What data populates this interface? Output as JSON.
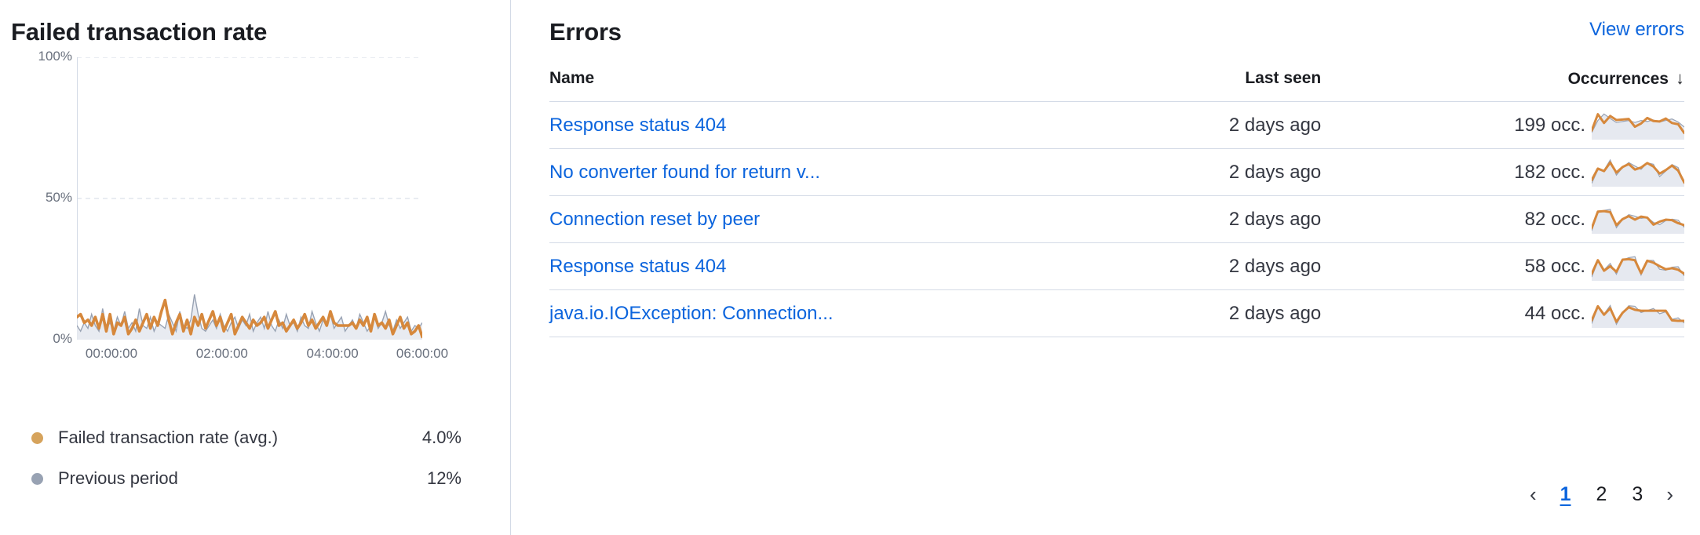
{
  "chart_panel": {
    "title": "Failed transaction rate",
    "legend": [
      {
        "label": "Failed transaction rate (avg.)",
        "value": "4.0%",
        "color": "#d6a35c"
      },
      {
        "label": "Previous period",
        "value": "12%",
        "color": "#98a2b3"
      }
    ]
  },
  "chart_data": {
    "type": "line",
    "title": "Failed transaction rate",
    "xlabel": "",
    "ylabel": "",
    "ylim": [
      0,
      100
    ],
    "yticks": [
      "0%",
      "50%",
      "100%"
    ],
    "ytick_values": [
      0,
      50,
      100
    ],
    "grid": true,
    "legend_position": "bottom",
    "x": [
      "00:00:00",
      "02:00:00",
      "04:00:00",
      "06:00:00"
    ],
    "xtick_labels": [
      "00:00:00",
      "02:00:00",
      "04:00:00",
      "06:00:00"
    ],
    "xtick_positions_pct": [
      10,
      42,
      74,
      100
    ],
    "series": [
      {
        "name": "Failed transaction rate (avg.)",
        "color": "#d6883c",
        "summary_value": "4.0%",
        "values": [
          8,
          9,
          6,
          7,
          5,
          8,
          4,
          9,
          3,
          9,
          2,
          6,
          5,
          8,
          2,
          4,
          7,
          3,
          6,
          9,
          4,
          8,
          5,
          10,
          14,
          7,
          2,
          6,
          9,
          3,
          7,
          2,
          8,
          5,
          9,
          4,
          7,
          10,
          5,
          8,
          3,
          6,
          9,
          2,
          5,
          8,
          6,
          4,
          7,
          5,
          6,
          8,
          4,
          7,
          10,
          5,
          6,
          3,
          5,
          7,
          4,
          6,
          9,
          5,
          7,
          4,
          6,
          8,
          5,
          10,
          6,
          5,
          5,
          5,
          5,
          6,
          4,
          7,
          5,
          8,
          3,
          9,
          5,
          6,
          4,
          7,
          2,
          5,
          8,
          4,
          6,
          2,
          3,
          5,
          1
        ]
      },
      {
        "name": "Previous period",
        "color": "#98a2b3",
        "summary_value": "12%",
        "values": [
          5,
          3,
          6,
          4,
          9,
          5,
          3,
          11,
          4,
          6,
          3,
          8,
          5,
          10,
          4,
          6,
          3,
          11,
          5,
          4,
          8,
          3,
          6,
          5,
          4,
          9,
          6,
          3,
          10,
          5,
          4,
          7,
          16,
          9,
          4,
          3,
          5,
          7,
          4,
          9,
          5,
          3,
          6,
          8,
          4,
          7,
          5,
          9,
          3,
          6,
          8,
          4,
          10,
          5,
          3,
          7,
          4,
          9,
          5,
          6,
          3,
          8,
          5,
          4,
          10,
          6,
          3,
          7,
          5,
          9,
          4,
          6,
          8,
          3,
          5,
          7,
          4,
          9,
          6,
          3,
          5,
          8,
          4,
          6,
          10,
          5,
          3,
          7,
          4,
          6,
          8,
          3,
          5,
          4,
          6
        ]
      }
    ]
  },
  "errors_panel": {
    "title": "Errors",
    "view_errors_label": "View errors",
    "columns": {
      "name": "Name",
      "last_seen": "Last seen",
      "occurrences": "Occurrences",
      "sort_arrow": "↓"
    },
    "rows": [
      {
        "name": "Response status 404",
        "last_seen": "2 days ago",
        "occurrences": "199 occ.",
        "spark_primary": [
          30,
          95,
          60,
          88,
          72,
          74,
          76,
          45,
          58,
          80,
          68,
          66,
          78,
          60,
          55,
          20
        ],
        "spark_previous": [
          22,
          70,
          96,
          78,
          62,
          66,
          70,
          62,
          70,
          66,
          72,
          64,
          70,
          76,
          64,
          44
        ]
      },
      {
        "name": "No converter found for return v...",
        "last_seen": "2 days ago",
        "occurrences": "182 occ.",
        "spark_primary": [
          20,
          66,
          56,
          90,
          50,
          72,
          84,
          62,
          70,
          88,
          74,
          46,
          60,
          78,
          58,
          10
        ]
      },
      {
        "name": "Connection reset by peer",
        "last_seen": "2 days ago",
        "occurrences": "82 occ.",
        "spark_primary": [
          16,
          82,
          84,
          80,
          28,
          52,
          64,
          50,
          62,
          58,
          30,
          42,
          50,
          48,
          36,
          28
        ]
      },
      {
        "name": "Response status 404",
        "last_seen": "2 days ago",
        "occurrences": "58 occ.",
        "spark_primary": [
          22,
          76,
          34,
          52,
          30,
          78,
          80,
          76,
          24,
          74,
          66,
          52,
          40,
          44,
          38,
          22
        ]
      },
      {
        "name": "java.io.IOException: Connection...",
        "last_seen": "2 days ago",
        "occurrences": "44 occ.",
        "spark_primary": [
          24,
          80,
          46,
          72,
          18,
          54,
          76,
          66,
          62,
          62,
          62,
          62,
          62,
          24,
          22,
          22
        ]
      }
    ],
    "pagination": {
      "prev": "‹",
      "next": "›",
      "pages": [
        "1",
        "2",
        "3"
      ],
      "active": "1"
    }
  }
}
